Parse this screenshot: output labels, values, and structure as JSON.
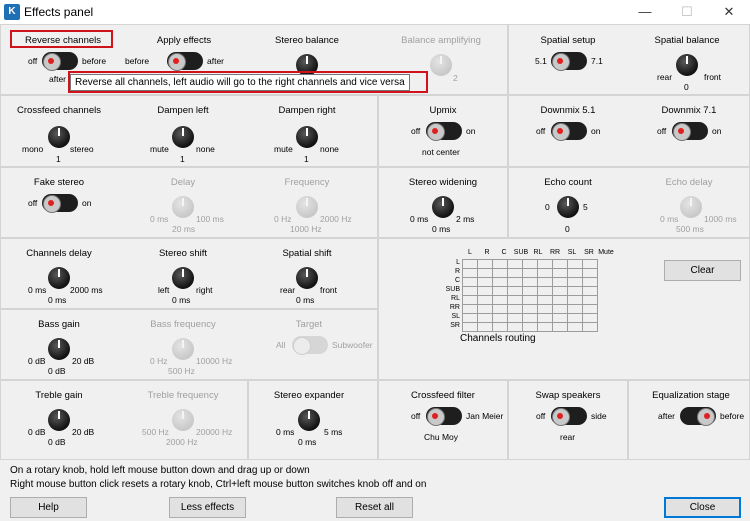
{
  "window": {
    "title": "Effects panel",
    "icon": "app-logo-icon",
    "minimize_icon": "minimize-icon",
    "maximize_icon": "maximize-icon",
    "close_icon": "close-icon"
  },
  "tooltip": "Reverse all channels, left audio will go to the right channels and vice versa",
  "reverse_channels": {
    "label": "Reverse channels",
    "left": "off",
    "right": "before",
    "below": "after"
  },
  "apply_effects": {
    "label": "Apply effects",
    "left": "before",
    "right": "after"
  },
  "stereo_balance": {
    "label": "Stereo balance"
  },
  "balance_amplifying": {
    "label": "Balance amplifying",
    "value": "2"
  },
  "spatial_setup": {
    "label": "Spatial setup",
    "left": "5.1",
    "right": "7.1"
  },
  "spatial_balance": {
    "label": "Spatial balance",
    "left": "rear",
    "right": "front",
    "value": "0"
  },
  "crossfeed_channels": {
    "label": "Crossfeed channels",
    "min": "mono",
    "max": "stereo",
    "value": "1"
  },
  "dampen_left": {
    "label": "Dampen left",
    "min": "mute",
    "max": "none",
    "value": "1"
  },
  "dampen_right": {
    "label": "Dampen right",
    "min": "mute",
    "max": "none",
    "value": "1"
  },
  "upmix": {
    "label": "Upmix",
    "left": "off",
    "right": "on",
    "below": "not center"
  },
  "downmix51": {
    "label": "Downmix 5.1",
    "left": "off",
    "right": "on"
  },
  "downmix71": {
    "label": "Downmix 7.1",
    "left": "off",
    "right": "on"
  },
  "fake_stereo": {
    "label": "Fake stereo",
    "left": "off",
    "right": "on"
  },
  "delay": {
    "label": "Delay",
    "min": "0 ms",
    "max": "100 ms",
    "value": "20 ms"
  },
  "frequency": {
    "label": "Frequency",
    "min": "0 Hz",
    "max": "2000 Hz",
    "value": "1000 Hz"
  },
  "stereo_widening": {
    "label": "Stereo widening",
    "min": "0 ms",
    "max": "2 ms",
    "value": "0 ms"
  },
  "echo_count": {
    "label": "Echo count",
    "min": "0",
    "max": "5",
    "value": "0"
  },
  "echo_delay": {
    "label": "Echo delay",
    "min": "0 ms",
    "max": "1000 ms",
    "value": "500 ms"
  },
  "channels_delay": {
    "label": "Channels delay",
    "min": "0 ms",
    "max": "2000 ms",
    "value": "0 ms"
  },
  "stereo_shift": {
    "label": "Stereo shift",
    "min": "left",
    "max": "right",
    "value": "0 ms"
  },
  "spatial_shift": {
    "label": "Spatial shift",
    "min": "rear",
    "max": "front",
    "value": "0 ms"
  },
  "routing": {
    "title": "Channels routing",
    "columns": [
      "L",
      "R",
      "C",
      "SUB",
      "RL",
      "RR",
      "SL",
      "SR",
      "Mute"
    ],
    "rows": [
      "L",
      "R",
      "C",
      "SUB",
      "RL",
      "RR",
      "SL",
      "SR"
    ],
    "clear_label": "Clear"
  },
  "bass_gain": {
    "label": "Bass gain",
    "min": "0 dB",
    "max": "20 dB",
    "value": "0 dB"
  },
  "bass_frequency": {
    "label": "Bass frequency",
    "min": "0 Hz",
    "max": "10000 Hz",
    "value": "500 Hz"
  },
  "target": {
    "label": "Target",
    "left": "All",
    "right": "Subwoofer"
  },
  "treble_gain": {
    "label": "Treble gain",
    "min": "0 dB",
    "max": "20 dB",
    "value": "0 dB"
  },
  "treble_frequency": {
    "label": "Treble frequency",
    "min": "500 Hz",
    "max": "20000 Hz",
    "value": "2000 Hz"
  },
  "stereo_expander": {
    "label": "Stereo expander",
    "min": "0 ms",
    "max": "5 ms",
    "value": "0 ms"
  },
  "crossfeed_filter": {
    "label": "Crossfeed filter",
    "left": "off",
    "right": "Jan Meier",
    "below": "Chu Moy"
  },
  "swap_speakers": {
    "label": "Swap speakers",
    "left": "off",
    "right": "side",
    "below": "rear"
  },
  "equalization_stage": {
    "label": "Equalization stage",
    "left": "after",
    "right": "before"
  },
  "footer": {
    "hint1": "On a rotary knob, hold left mouse button down and drag up or down",
    "hint2": "Right mouse button click resets a rotary knob, Ctrl+left mouse button switches knob off and on",
    "help": "Help",
    "less_effects": "Less effects",
    "reset_all": "Reset all",
    "close": "Close"
  },
  "colors": {
    "highlight": "#d0121c",
    "toggle_dot": "#e02020",
    "accent": "#0078d7"
  }
}
